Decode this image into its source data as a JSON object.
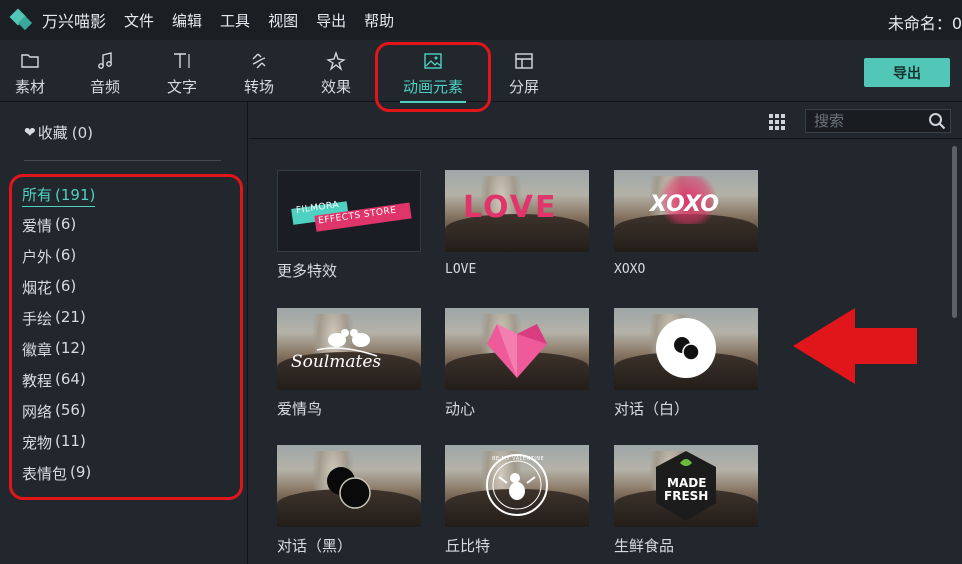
{
  "menubar": {
    "app_title": "万兴喵影",
    "items": [
      "文件",
      "编辑",
      "工具",
      "视图",
      "导出",
      "帮助"
    ],
    "doc_title": "未命名：0"
  },
  "toolbar": {
    "tabs": [
      {
        "label": "素材",
        "icon": "folder-icon"
      },
      {
        "label": "音频",
        "icon": "music-note-icon"
      },
      {
        "label": "文字",
        "icon": "text-icon"
      },
      {
        "label": "转场",
        "icon": "transition-icon"
      },
      {
        "label": "效果",
        "icon": "effects-icon"
      },
      {
        "label": "动画元素",
        "icon": "image-icon",
        "active": true
      },
      {
        "label": "分屏",
        "icon": "split-screen-icon"
      }
    ],
    "export_label": "导出"
  },
  "sidebar": {
    "favorites_label": "收藏",
    "favorites_count": "(0)",
    "categories": [
      {
        "label": "所有",
        "count": "(191)",
        "active": true
      },
      {
        "label": "爱情",
        "count": "(6)"
      },
      {
        "label": "户外",
        "count": "(6)"
      },
      {
        "label": "烟花",
        "count": "(6)"
      },
      {
        "label": "手绘",
        "count": "(21)"
      },
      {
        "label": "徽章",
        "count": "(12)"
      },
      {
        "label": "教程",
        "count": "(64)"
      },
      {
        "label": "网络",
        "count": "(56)"
      },
      {
        "label": "宠物",
        "count": "(11)"
      },
      {
        "label": "表情包",
        "count": "(9)"
      }
    ]
  },
  "content": {
    "search_placeholder": "搜索",
    "tiles": [
      {
        "label": "更多特效",
        "overlay": "FILMORA",
        "overlay2": "EFFECTS STORE"
      },
      {
        "label": "LOVE",
        "overlay": "LOVE"
      },
      {
        "label": "XOXO",
        "overlay": "XOXO"
      },
      {
        "label": "爱情鸟",
        "overlay": "Soulmates"
      },
      {
        "label": "动心"
      },
      {
        "label": "对话（白）"
      },
      {
        "label": "对话（黑）"
      },
      {
        "label": "丘比特",
        "overlay": "BE MY VALENTINE"
      },
      {
        "label": "生鲜食品",
        "overlay": "MADE",
        "overlay2": "FRESH"
      }
    ]
  },
  "colors": {
    "accent": "#4fd1c1",
    "annotation": "#e0161b",
    "background": "#22272e"
  }
}
